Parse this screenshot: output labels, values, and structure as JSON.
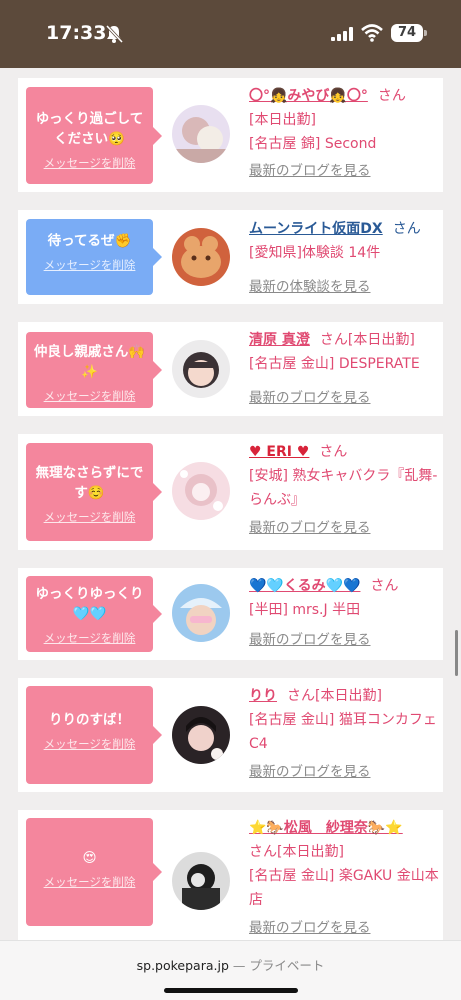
{
  "status_bar": {
    "time": "17:33",
    "battery": "74"
  },
  "cards": [
    {
      "message": "ゆっくり過ごしてください🥺",
      "delete_label": "メッセージを削除",
      "name": "〇°👧みやび👧〇°",
      "suffix": "さん",
      "details": [
        "[本日出勤]",
        "[名古屋 錦] Second"
      ],
      "link": "最新のブログを見る",
      "bubble_color": "#f4869d"
    },
    {
      "message": "待ってるぜ✊",
      "delete_label": "メッセージを削除",
      "name": "ムーンライト仮面DX",
      "suffix": "さん",
      "details": [
        "[愛知県]体験談 14件"
      ],
      "link": "最新の体験談を見る",
      "bubble_color": "#7aacf5"
    },
    {
      "message": "仲良し親戚さん🙌✨",
      "delete_label": "メッセージを削除",
      "name": "清原 真澄",
      "suffix": "さん[本日出勤]",
      "details": [
        "[名古屋 金山] DESPERATE"
      ],
      "link": "最新のブログを見る",
      "bubble_color": "#f4869d"
    },
    {
      "message": "無理なさらずにです☺️",
      "delete_label": "メッセージを削除",
      "name": "♥ ERI ♥",
      "suffix": "さん",
      "details": [
        "[安城] 熟女キャバクラ『乱舞-らんぶ』"
      ],
      "link": "最新のブログを見る",
      "bubble_color": "#f4869d"
    },
    {
      "message": "ゆっくりゆっくり🩵🩵",
      "delete_label": "メッセージを削除",
      "name": "💙🩵くるみ🩵💙",
      "suffix": "さん",
      "details": [
        "[半田] mrs.J 半田"
      ],
      "link": "最新のブログを見る",
      "bubble_color": "#f4869d"
    },
    {
      "message": "りりのすば！",
      "delete_label": "メッセージを削除",
      "name": "りり",
      "suffix": "さん[本日出勤]",
      "details": [
        "[名古屋 金山] 猫耳コンカフェ C4"
      ],
      "link": "最新のブログを見る",
      "bubble_color": "#f4869d"
    },
    {
      "message": "😍",
      "delete_label": "メッセージを削除",
      "name": "⭐🐎松風　紗理奈🐎⭐",
      "suffix": "",
      "details": [
        "さん[本日出勤]",
        "[名古屋 金山] 楽GAKU 金山本店"
      ],
      "link": "最新のブログを見る",
      "bubble_color": "#f4869d"
    }
  ],
  "browser": {
    "domain": "sp.pokepara.jp",
    "mode": " — プライベート"
  }
}
